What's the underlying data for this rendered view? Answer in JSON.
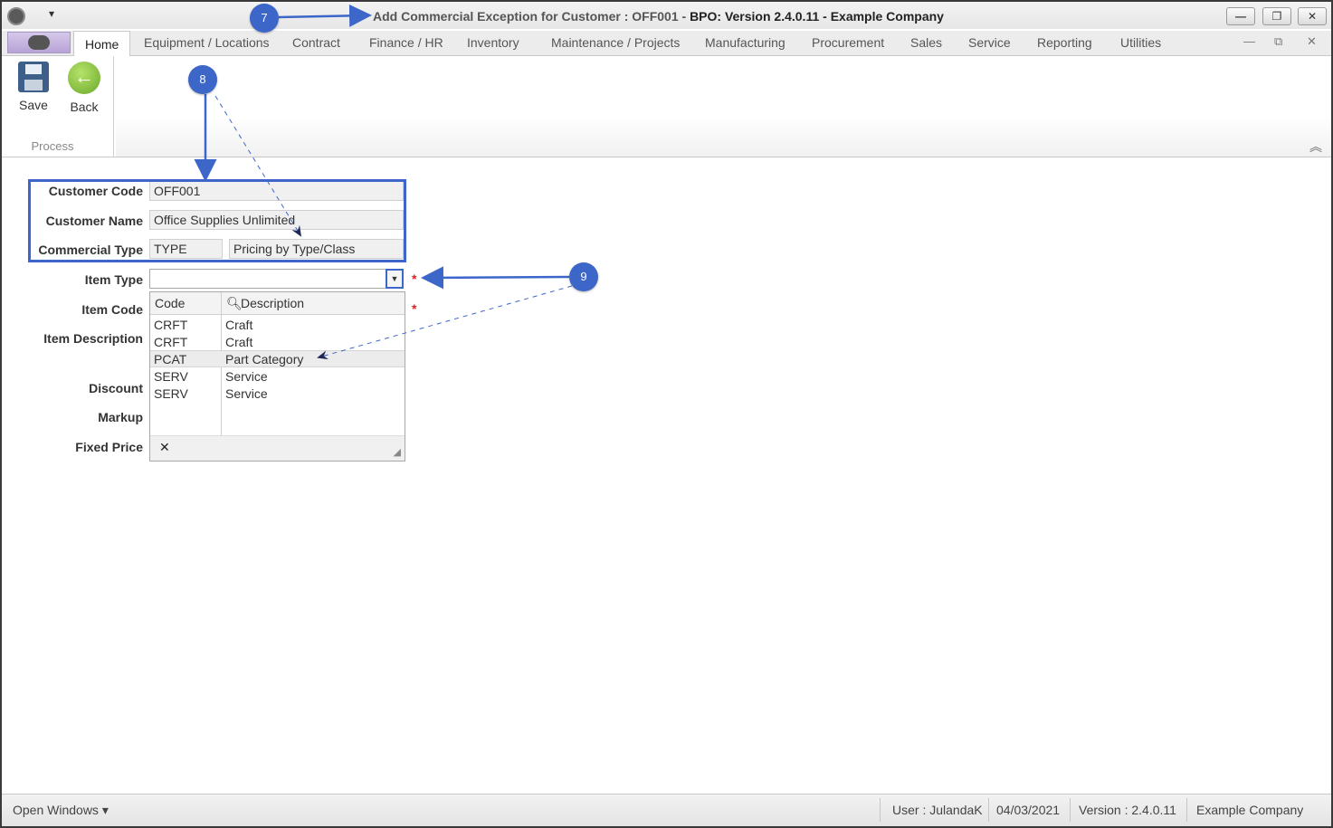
{
  "window": {
    "title_prefix": "Add Commercial Exception for Customer : OFF001 - ",
    "title_suffix": "BPO: Version 2.4.0.11 - Example Company",
    "qa_dropdown": "▾",
    "minimize": "—",
    "restore": "❐",
    "close": "✕"
  },
  "tabs": [
    {
      "label": "Home"
    },
    {
      "label": "Equipment / Locations"
    },
    {
      "label": "Contract"
    },
    {
      "label": "Finance / HR"
    },
    {
      "label": "Inventory"
    },
    {
      "label": "Maintenance / Projects"
    },
    {
      "label": "Manufacturing"
    },
    {
      "label": "Procurement"
    },
    {
      "label": "Sales"
    },
    {
      "label": "Service"
    },
    {
      "label": "Reporting"
    },
    {
      "label": "Utilities"
    }
  ],
  "mdi": {
    "minimize": "—",
    "restore": "⧉",
    "close": "✕"
  },
  "ribbon": {
    "save_label": "Save",
    "back_label": "Back",
    "group_label": "Process",
    "collapse": "︽"
  },
  "form": {
    "customer_code_label": "Customer Code",
    "customer_code_value": "OFF001",
    "customer_name_label": "Customer Name",
    "customer_name_value": "Office Supplies Unlimited",
    "commercial_type_label": "Commercial Type",
    "commercial_type_code": "TYPE",
    "commercial_type_desc": "Pricing by Type/Class",
    "item_type_label": "Item Type",
    "item_type_value": "",
    "item_code_label": "Item Code",
    "item_description_label": "Item Description",
    "discount_label": "Discount",
    "markup_label": "Markup",
    "fixed_price_label": "Fixed Price",
    "required_mark": "*"
  },
  "dropdown": {
    "col_code": "Code",
    "col_desc": "Description",
    "rows": [
      {
        "code": "CRFT",
        "desc": "Craft"
      },
      {
        "code": "CRFT",
        "desc": "Craft"
      },
      {
        "code": "PCAT",
        "desc": "Part Category"
      },
      {
        "code": "SERV",
        "desc": "Service"
      },
      {
        "code": "SERV",
        "desc": "Service"
      }
    ],
    "selected_index": 2,
    "clear": "✕",
    "grip": "◢"
  },
  "callouts": {
    "c7": "7",
    "c8": "8",
    "c9": "9"
  },
  "status": {
    "open_windows": "Open Windows ▾",
    "user": "User : JulandaK",
    "date": "04/03/2021",
    "version": "Version : 2.4.0.11",
    "company": "Example Company"
  },
  "colors": {
    "accent": "#3d66c9",
    "required": "#dd2222"
  }
}
